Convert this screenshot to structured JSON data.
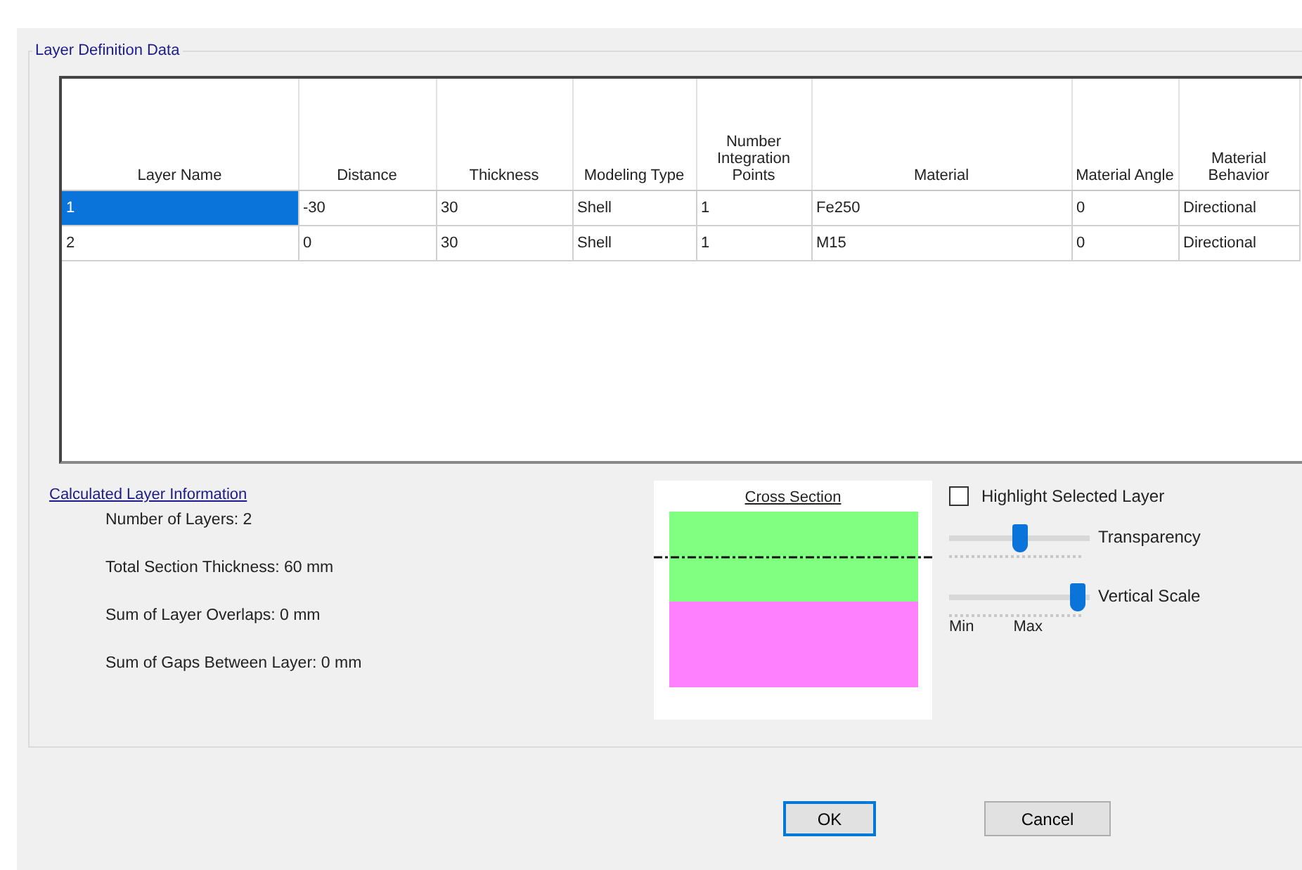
{
  "group_title": "Layer Definition Data",
  "table": {
    "columns": [
      "Layer Name",
      "Distance",
      "Thickness",
      "Modeling Type",
      "Number Integration Points",
      "Material",
      "Material Angle",
      "Material Behavior"
    ],
    "rows": [
      {
        "cells": [
          {
            "text": "1",
            "selected": true
          },
          {
            "text": "-30",
            "selected": false
          },
          {
            "text": "30",
            "selected": false
          },
          {
            "text": "Shell",
            "selected": false
          },
          {
            "text": "1",
            "selected": false
          },
          {
            "text": "Fe250",
            "selected": false
          },
          {
            "text": "0",
            "selected": false
          },
          {
            "text": "Directional",
            "selected": false
          }
        ]
      },
      {
        "cells": [
          {
            "text": "2",
            "selected": false
          },
          {
            "text": "0",
            "selected": false
          },
          {
            "text": "30",
            "selected": false
          },
          {
            "text": "Shell",
            "selected": false
          },
          {
            "text": "1",
            "selected": false
          },
          {
            "text": "M15",
            "selected": false
          },
          {
            "text": "0",
            "selected": false
          },
          {
            "text": "Directional",
            "selected": false
          }
        ]
      }
    ]
  },
  "calculated_info": {
    "title": "Calculated Layer Information",
    "lines": [
      "Number of Layers:  2",
      "Total Section Thickness:  60 mm",
      "Sum of Layer Overlaps:  0 mm",
      "Sum of Gaps Between Layer:  0 mm"
    ]
  },
  "cross_section": {
    "title": "Cross Section",
    "layers": [
      {
        "color": "#80ff80"
      },
      {
        "color": "#ff80ff"
      }
    ]
  },
  "highlight_checkbox": {
    "label": "Highlight Selected Layer",
    "checked": false
  },
  "sliders": [
    {
      "label": "Transparency",
      "level": 0.5
    },
    {
      "label": "Vertical Scale",
      "level": 0.97,
      "min_label": "Min",
      "max_label": "Max"
    }
  ],
  "buttons": [
    {
      "label": "OK",
      "focused": true
    },
    {
      "label": "Cancel",
      "focused": false
    }
  ]
}
